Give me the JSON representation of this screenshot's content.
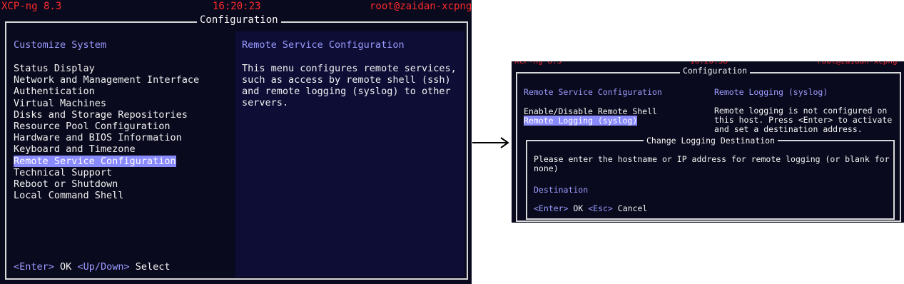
{
  "left": {
    "header": {
      "product": "XCP-ng 8.3",
      "time": "16:20:23",
      "host": "root@zaidan-xcpng"
    },
    "frame_title": "Configuration",
    "menu_title": "Customize System",
    "menu_items": [
      "Status Display",
      "Network and Management Interface",
      "Authentication",
      "Virtual Machines",
      "Disks and Storage Repositories",
      "Resource Pool Configuration",
      "Hardware and BIOS Information",
      "Keyboard and Timezone",
      "Remote Service Configuration",
      "Technical Support",
      "Reboot or Shutdown",
      "Local Command Shell"
    ],
    "selected_index": 8,
    "desc_title": "Remote Service Configuration",
    "desc_lines": [
      "This menu configures remote services,",
      "such as access by remote shell (ssh)",
      "and remote logging (syslog) to other",
      "servers."
    ],
    "footer": {
      "enter_key": "<Enter>",
      "enter_action": "OK",
      "nav_key": "<Up/Down>",
      "nav_action": "Select"
    }
  },
  "right": {
    "frame_title": "Configuration",
    "menu_title": "Remote Service Configuration",
    "menu_items": [
      "Enable/Disable Remote Shell",
      "Remote Logging (syslog)"
    ],
    "selected_index": 1,
    "desc_title": "Remote Logging (syslog)",
    "desc_lines": [
      "Remote logging is not configured on",
      "this host.  Press <Enter> to activate",
      "and set a destination address."
    ],
    "dialog": {
      "title": "Change Logging Destination",
      "prompt_lines": [
        "Please enter the hostname or IP address for remote logging (or blank for",
        "none)"
      ],
      "field_label": "Destination",
      "enter_key": "<Enter>",
      "enter_action": "OK",
      "esc_key": "<Esc>",
      "esc_action": "Cancel"
    }
  },
  "colors": {
    "terminal_bg": "#0a0a1e",
    "panel_bg": "#0d0d36",
    "header_red": "#ff2a2a",
    "accent_blue": "#9b9bff",
    "highlight": "#8a8aff"
  }
}
